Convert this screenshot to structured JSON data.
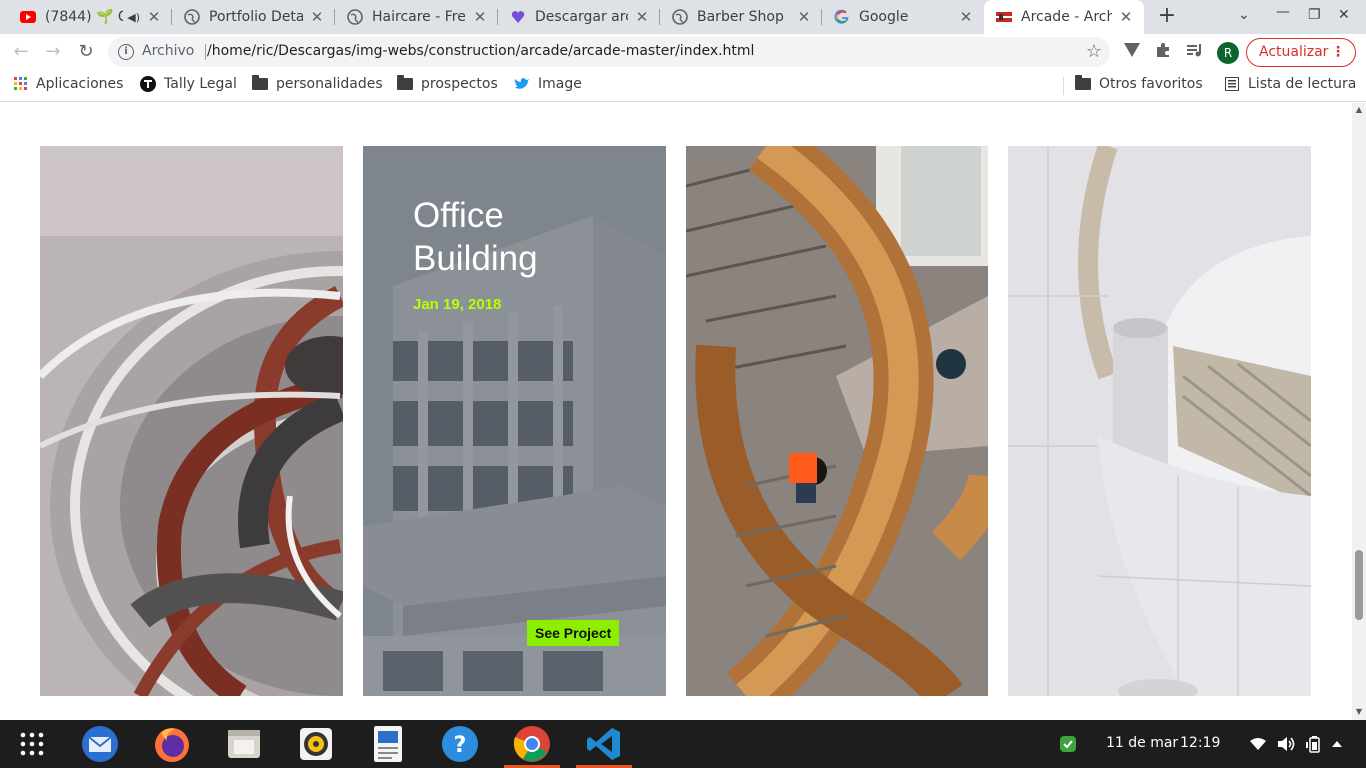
{
  "tabs": [
    {
      "title": "(7844) 🌱 C",
      "favicon": "youtube-icon",
      "extra": "speaker-icon"
    },
    {
      "title": "Portfolio Deta",
      "favicon": "globe-icon"
    },
    {
      "title": "Haircare - Free",
      "favicon": "globe-icon"
    },
    {
      "title": "Descargar arc",
      "favicon": "heart-icon"
    },
    {
      "title": "Barber Shop",
      "favicon": "globe-icon"
    },
    {
      "title": "Google",
      "favicon": "google-icon"
    },
    {
      "title": "Arcade - Archi",
      "favicon": "site-icon",
      "active": true
    }
  ],
  "toolbar": {
    "scheme": "Archivo",
    "url": "/home/ric/Descargas/img-webs/construction/arcade/arcade-master/index.html",
    "profile_initial": "R",
    "update_label": "Actualizar"
  },
  "bookmarks": {
    "left": [
      {
        "label": "Aplicaciones",
        "icon": "apps-grid-icon"
      },
      {
        "label": "Tally Legal",
        "icon": "tally-icon"
      },
      {
        "label": "personalidades",
        "icon": "folder-icon"
      },
      {
        "label": "prospectos",
        "icon": "folder-icon"
      },
      {
        "label": "Image",
        "icon": "twitter-icon"
      }
    ],
    "other": "Otros favoritos",
    "reading_list": "Lista de lectura"
  },
  "project": {
    "title": "Office Building",
    "date": "Jan 19, 2018",
    "button": "See Project"
  },
  "taskbar": {
    "date": "11 de mar",
    "time": "12:19"
  },
  "colors": {
    "accent_green": "#8cee00",
    "date_green": "#b8ff00",
    "update_red": "#d93025"
  }
}
